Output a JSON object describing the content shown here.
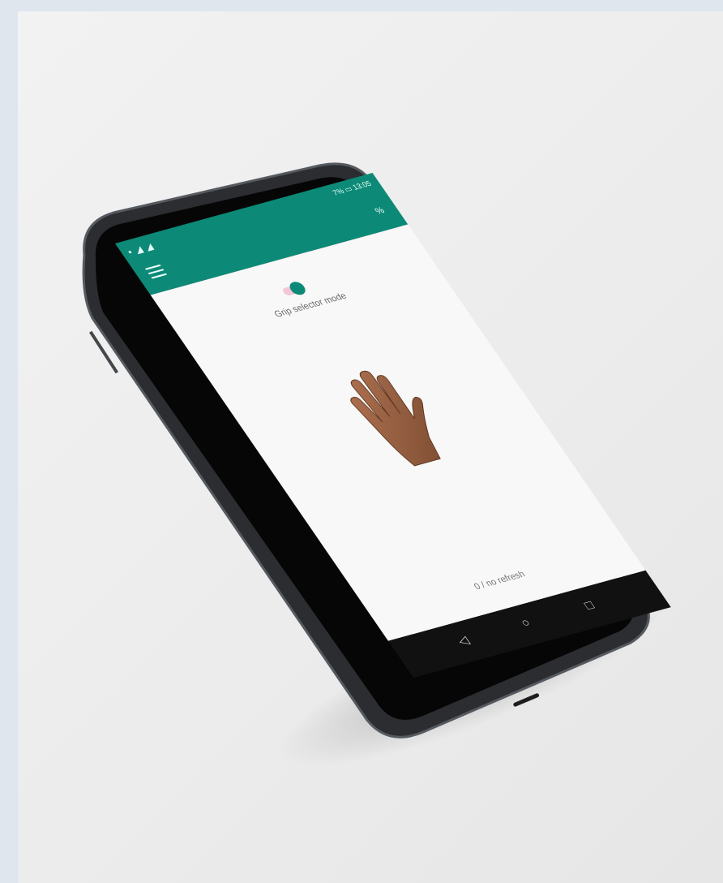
{
  "status_bar": {
    "left_icons": "▪ ◢ ◢",
    "right_text": "7% ▭ 13:05"
  },
  "app_bar": {
    "menu_icon": "menu-icon",
    "action_icon": "%"
  },
  "toggle": {
    "state": "on",
    "accent_color": "#0c8a77",
    "track_color": "#f2c6d7"
  },
  "mode_label": "Grip selector mode",
  "hand_icon": "open-hand",
  "counter_text": "0 / no refresh",
  "nav": {
    "back": "◁",
    "home": "○",
    "recents": "□"
  },
  "colors": {
    "primary": "#0c8a77",
    "screen_bg": "#f8f8f8",
    "phone_frame": "#2b2d30"
  }
}
